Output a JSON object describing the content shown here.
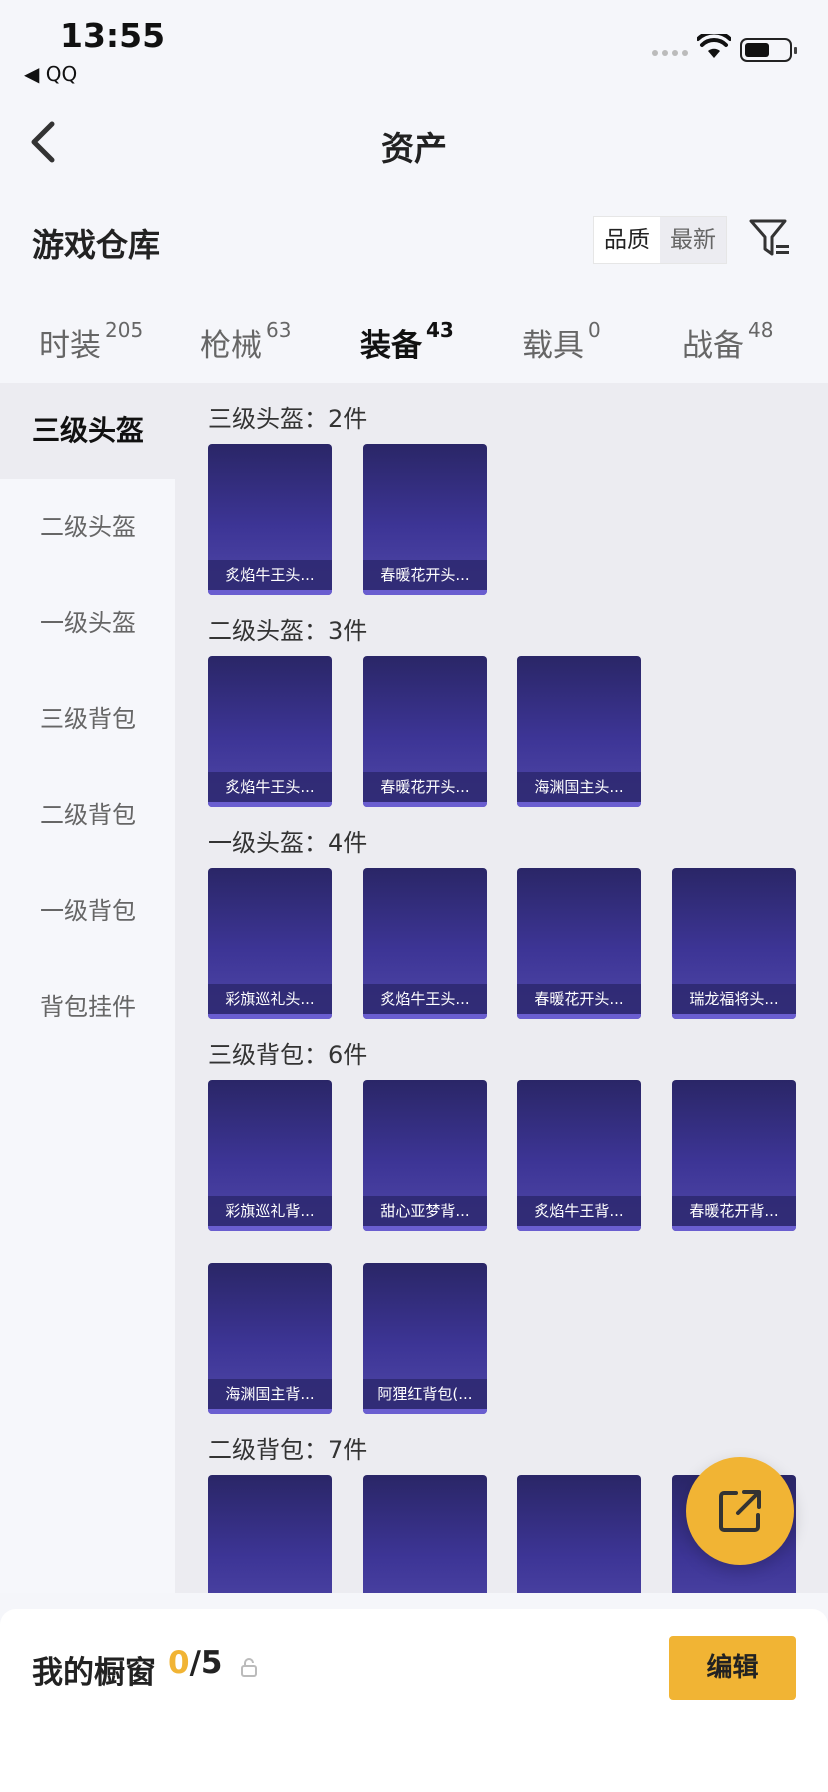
{
  "status_bar": {
    "time": "13:55",
    "back_app": "◀ QQ"
  },
  "nav": {
    "title": "资产"
  },
  "header": {
    "title": "游戏仓库",
    "sort_quality": "品质",
    "sort_newest": "最新"
  },
  "tabs": [
    {
      "label": "时装",
      "count": "205"
    },
    {
      "label": "枪械",
      "count": "63"
    },
    {
      "label": "装备",
      "count": "43"
    },
    {
      "label": "载具",
      "count": "0"
    },
    {
      "label": "战备",
      "count": "48"
    }
  ],
  "sidebar": [
    {
      "label": "三级头盔"
    },
    {
      "label": "二级头盔"
    },
    {
      "label": "一级头盔"
    },
    {
      "label": "三级背包"
    },
    {
      "label": "二级背包"
    },
    {
      "label": "一级背包"
    },
    {
      "label": "背包挂件"
    }
  ],
  "sections": [
    {
      "title": "三级头盔：2件",
      "items": [
        "炙焰牛王头...",
        "春暖花开头..."
      ]
    },
    {
      "title": "二级头盔：3件",
      "items": [
        "炙焰牛王头...",
        "春暖花开头...",
        "海渊国主头..."
      ]
    },
    {
      "title": "一级头盔：4件",
      "items": [
        "彩旗巡礼头...",
        "炙焰牛王头...",
        "春暖花开头...",
        "瑞龙福将头..."
      ]
    },
    {
      "title": "三级背包：6件",
      "items": [
        "彩旗巡礼背...",
        "甜心亚梦背...",
        "炙焰牛王背...",
        "春暖花开背...",
        "海渊国主背...",
        "阿狸红背包(..."
      ]
    },
    {
      "title": "二级背包：7件",
      "items": [
        "",
        "",
        "",
        ""
      ]
    }
  ],
  "bottom_bar": {
    "label": "我的橱窗",
    "current": "0",
    "total": "/5",
    "edit": "编辑"
  },
  "colors": {
    "accent": "#f1b434",
    "card_bg": "#3d3596"
  }
}
